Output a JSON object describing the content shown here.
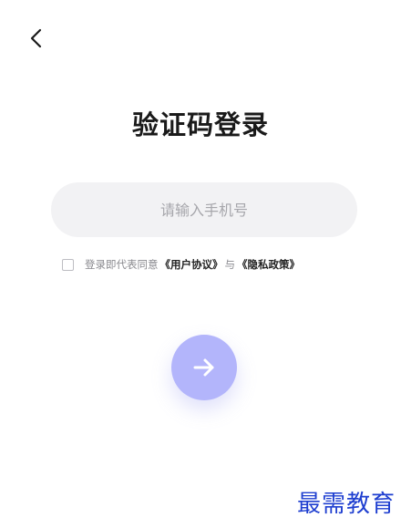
{
  "header": {
    "back_icon": "chevron-left-icon"
  },
  "title": "验证码登录",
  "phone": {
    "placeholder": "请输入手机号",
    "value": ""
  },
  "agreement": {
    "checked": false,
    "prefix": "登录即代表同意",
    "user_agreement": "《用户协议》",
    "conjunction": "与",
    "privacy_policy": "《隐私政策》"
  },
  "submit": {
    "icon": "arrow-right-icon",
    "color": "#b3b5fb"
  },
  "watermark": "最需教育"
}
